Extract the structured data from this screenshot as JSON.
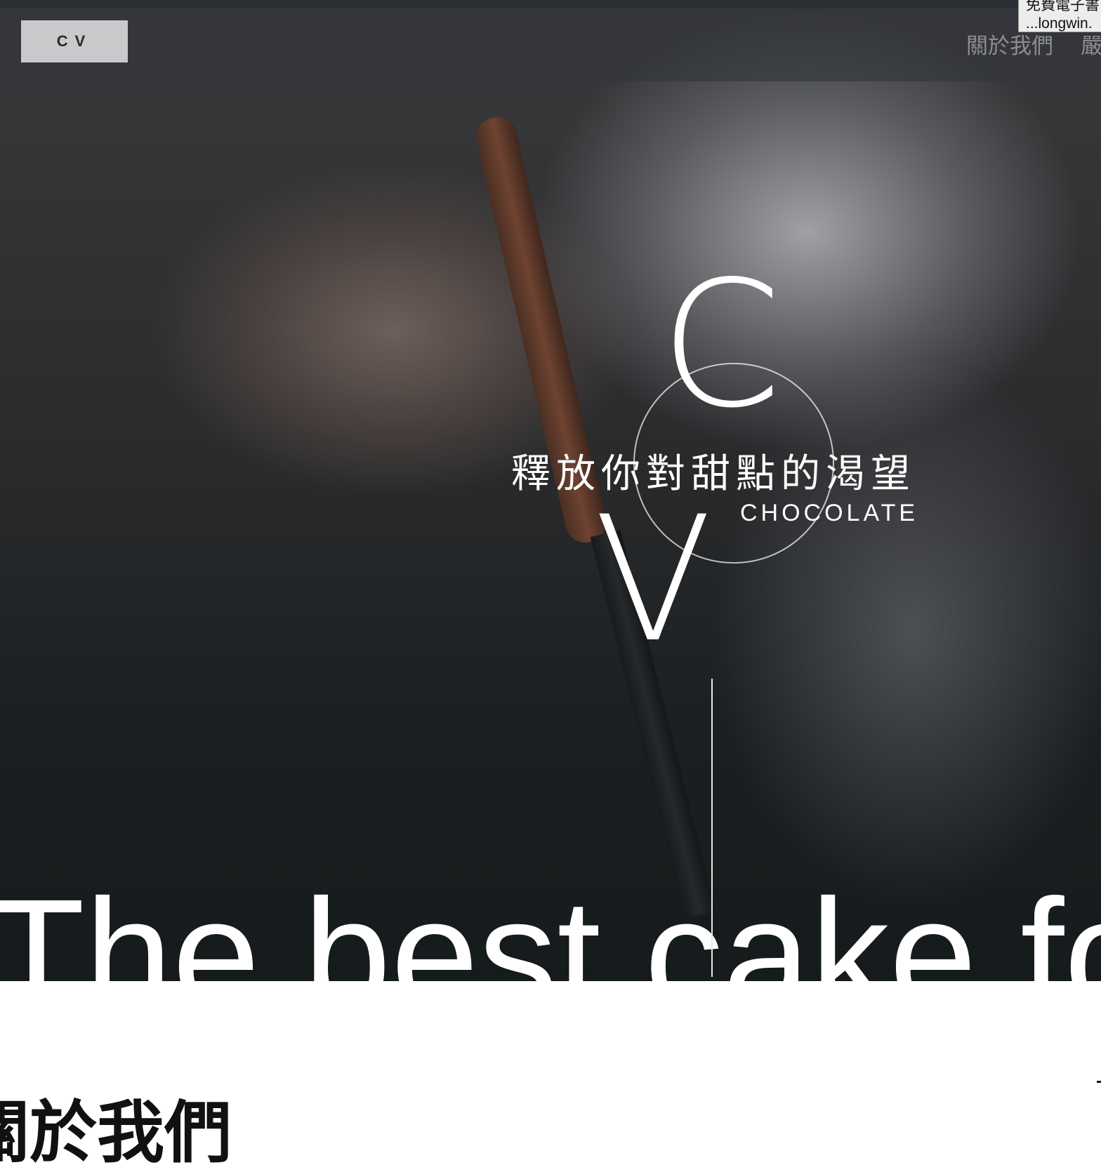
{
  "header": {
    "logo_text": "CV",
    "nav": [
      "關於我們",
      "嚴"
    ]
  },
  "tooltip": {
    "line1": "免費電子書",
    "line2": "...longwin."
  },
  "hero": {
    "emblem_c": "C",
    "emblem_v": "V",
    "tagline_zh": "釋放你對甜點的渴望",
    "tagline_en": "CHOCOLATE",
    "headline": "The best cake for you"
  },
  "about": {
    "title": "關於我們"
  }
}
